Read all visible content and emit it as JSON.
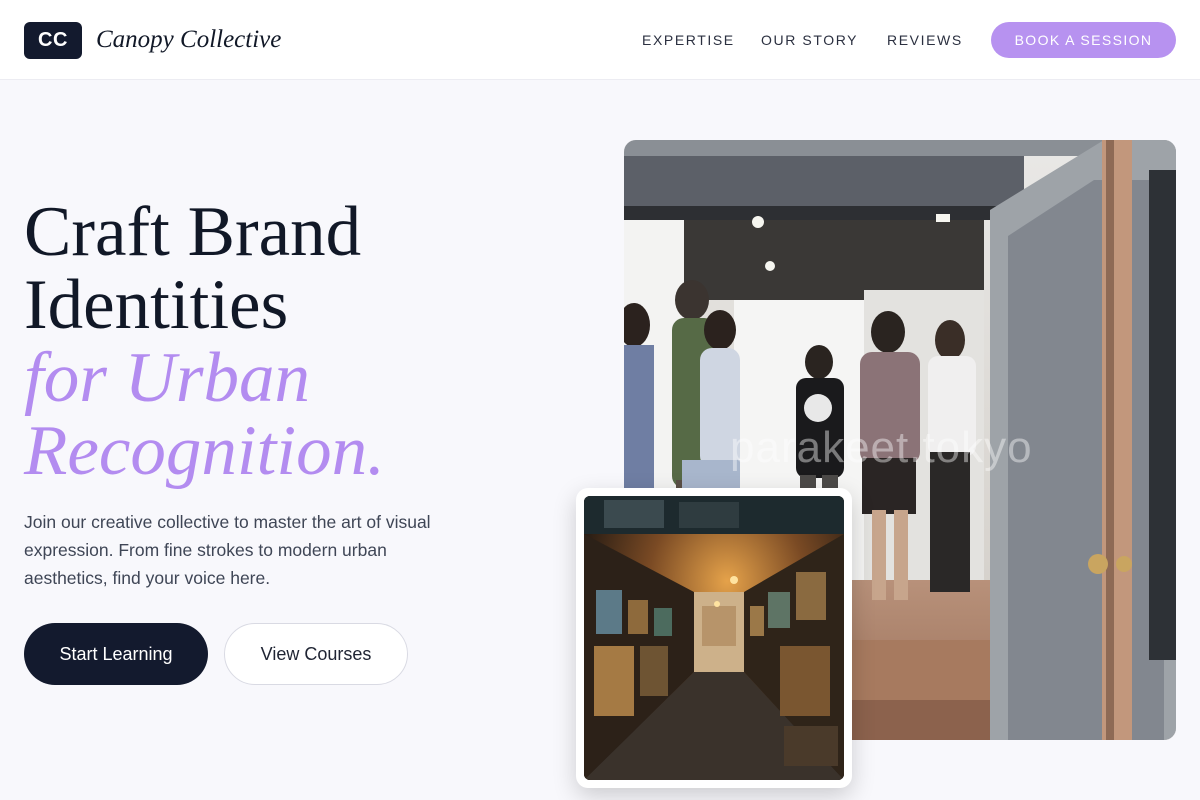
{
  "header": {
    "logo_mark": "CC",
    "brand_name": "Canopy Collective",
    "nav": [
      {
        "label": "EXPERTISE"
      },
      {
        "label": "OUR STORY"
      },
      {
        "label": "REVIEWS"
      }
    ],
    "cta_label": "BOOK A SESSION"
  },
  "hero": {
    "title_line1": "Craft Brand",
    "title_line2": "Identities",
    "title_accent1": "for Urban",
    "title_accent2": "Recognition.",
    "description": "Join our creative collective to master the art of visual expression. From fine strokes to modern urban aesthetics, find your voice here.",
    "primary_button": "Start Learning",
    "secondary_button": "View Courses"
  },
  "media": {
    "main_photo_watermark": "parakeet.tokyo",
    "main_photo_subject": "gallery opening crowd",
    "inset_photo_subject": "art shop corridor"
  },
  "colors": {
    "accent": "#b38cf0",
    "cta_bg": "#b792f0",
    "dark": "#131a2e",
    "page_bg": "#f8f8fc"
  }
}
